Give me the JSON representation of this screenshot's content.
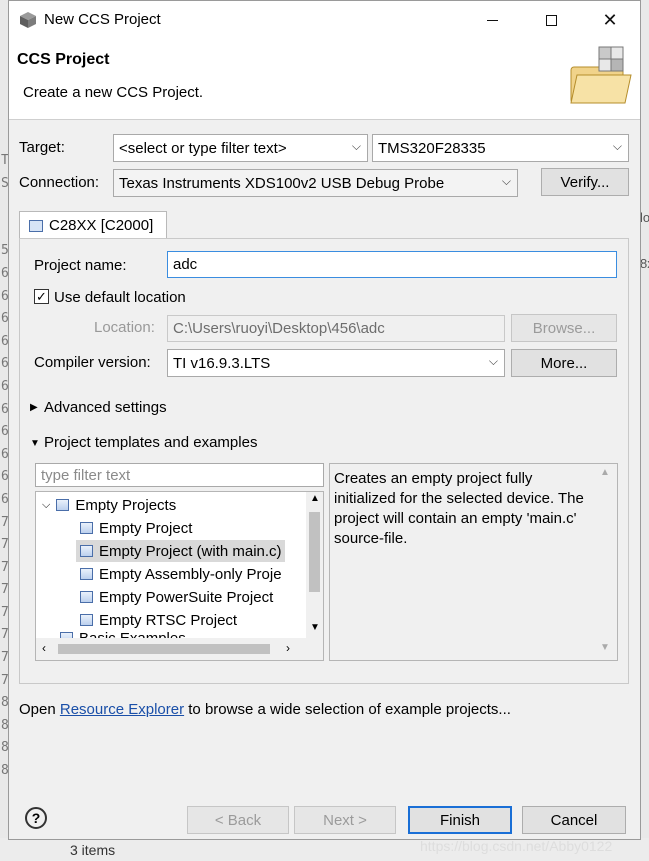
{
  "window": {
    "title": "New CCS Project"
  },
  "banner": {
    "title": "CCS Project",
    "subtitle": "Create a new CCS Project."
  },
  "target": {
    "label": "Target:",
    "filter_placeholder": "<select or type filter text>",
    "device": "TMS320F28335"
  },
  "connection": {
    "label": "Connection:",
    "value": "Texas Instruments XDS100v2 USB Debug Probe",
    "verify_label": "Verify..."
  },
  "tab": {
    "label": "C28XX [C2000]"
  },
  "project_name": {
    "label": "Project name:",
    "value": "adc"
  },
  "use_default": {
    "label": "Use default location",
    "checked": true
  },
  "location": {
    "label": "Location:",
    "value": "C:\\Users\\ruoyi\\Desktop\\456\\adc",
    "browse_label": "Browse..."
  },
  "compiler": {
    "label": "Compiler version:",
    "value": "TI v16.9.3.LTS",
    "more_label": "More..."
  },
  "advanced": {
    "label": "Advanced settings"
  },
  "templates": {
    "label": "Project templates and examples",
    "filter_placeholder": "type filter text",
    "group": "Empty Projects",
    "items": [
      "Empty Project",
      "Empty Project (with main.c)",
      "Empty Assembly-only Proje",
      "Empty PowerSuite Project",
      "Empty RTSC Project"
    ],
    "selected_index": 1,
    "partial_item": "Basic Examples",
    "description": "Creates an empty project fully initialized for the selected device. The project will contain an empty 'main.c' source-file."
  },
  "resource": {
    "prefix": "Open ",
    "link": "Resource Explorer",
    "suffix": " to browse a wide selection of example projects..."
  },
  "buttons": {
    "back": "< Back",
    "next": "Next >",
    "finish": "Finish",
    "cancel": "Cancel"
  },
  "background": {
    "gutter_numbers": [
      "T",
      "S",
      "",
      "",
      "5",
      "6",
      "6",
      "6",
      "6",
      "6",
      "6",
      "6",
      "6",
      "6",
      "6",
      "6",
      "7",
      "7",
      "7",
      "7",
      "7",
      "7",
      "7",
      "7",
      "8",
      "8",
      "8",
      "8"
    ],
    "right_snippets": [
      "lo",
      "8x"
    ],
    "status_text": "3 items",
    "watermark": "https://blog.csdn.net/Abby0122"
  }
}
